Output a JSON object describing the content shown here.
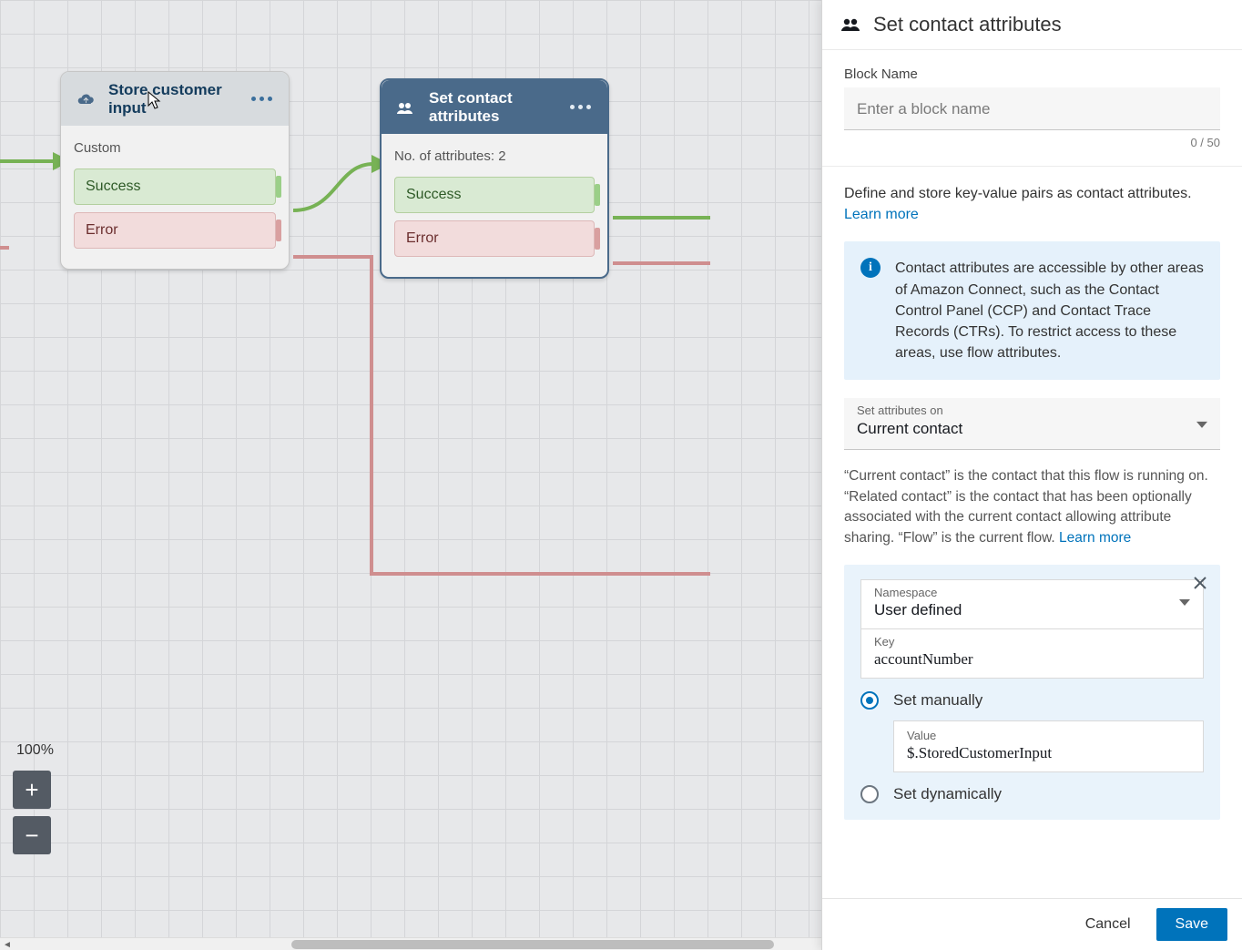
{
  "canvas": {
    "zoom": "100%",
    "node1": {
      "title": "Store customer input",
      "meta": "Custom",
      "port_success": "Success",
      "port_error": "Error"
    },
    "node2": {
      "title": "Set contact attributes",
      "meta": "No. of attributes: 2",
      "port_success": "Success",
      "port_error": "Error"
    }
  },
  "panel": {
    "title": "Set contact attributes",
    "block_name_label": "Block Name",
    "block_name_placeholder": "Enter a block name",
    "block_name_count": "0 / 50",
    "desc": "Define and store key-value pairs as contact attributes.",
    "learn_more": "Learn more",
    "info_text": "Contact attributes are accessible by other areas of Amazon Connect, such as the Contact Control Panel (CCP) and Contact Trace Records (CTRs). To restrict access to these areas, use flow attributes.",
    "select_label": "Set attributes on",
    "select_value": "Current contact",
    "helper": "“Current contact” is the contact that this flow is running on. “Related contact” is the contact that has been optionally associated with the current contact allowing attribute sharing. “Flow” is the current flow. ",
    "attr": {
      "namespace_label": "Namespace",
      "namespace_value": "User defined",
      "key_label": "Key",
      "key_value": "accountNumber",
      "radio_manual": "Set manually",
      "value_label": "Value",
      "value_value": "$.StoredCustomerInput",
      "radio_dynamic": "Set dynamically"
    },
    "cancel": "Cancel",
    "save": "Save"
  }
}
